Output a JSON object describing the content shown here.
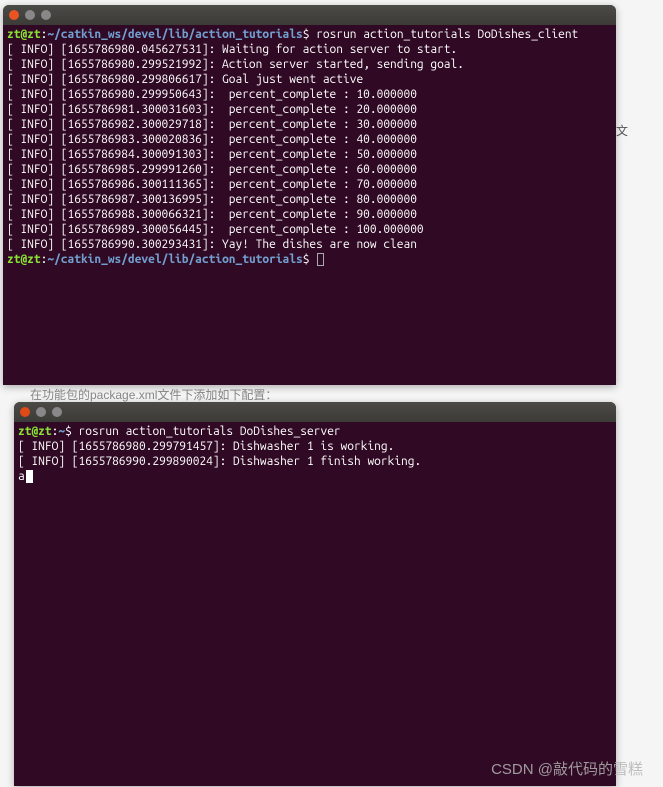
{
  "terminal1": {
    "prompt_user": "zt@zt",
    "prompt_sep": ":",
    "prompt_path": "~/catkin_ws/devel/lib/action_tutorials",
    "prompt_dollar": "$",
    "command": "rosrun action_tutorials DoDishes_client",
    "lines": [
      "[ INFO] [1655786980.045627531]: Waiting for action server to start.",
      "[ INFO] [1655786980.299521992]: Action server started, sending goal.",
      "[ INFO] [1655786980.299806617]: Goal just went active",
      "[ INFO] [1655786980.299950643]:  percent_complete : 10.000000",
      "[ INFO] [1655786981.300031603]:  percent_complete : 20.000000",
      "[ INFO] [1655786982.300029718]:  percent_complete : 30.000000",
      "[ INFO] [1655786983.300020836]:  percent_complete : 40.000000",
      "[ INFO] [1655786984.300091303]:  percent_complete : 50.000000",
      "[ INFO] [1655786985.299991260]:  percent_complete : 60.000000",
      "[ INFO] [1655786986.300111365]:  percent_complete : 70.000000",
      "[ INFO] [1655786987.300136995]:  percent_complete : 80.000000",
      "[ INFO] [1655786988.300066321]:  percent_complete : 90.000000",
      "[ INFO] [1655786989.300056445]:  percent_complete : 100.000000",
      "[ INFO] [1655786990.300293431]: Yay! The dishes are now clean"
    ]
  },
  "terminal2": {
    "prompt_user": "zt@zt",
    "prompt_sep": ":",
    "prompt_path": "~",
    "prompt_dollar": "$",
    "command": "rosrun action_tutorials DoDishes_server",
    "lines": [
      "[ INFO] [1655786980.299791457]: Dishwasher 1 is working.",
      "[ INFO] [1655786990.299890024]: Dishwasher 1 finish working."
    ],
    "trailing": "a"
  },
  "watermark": "CSDN @敲代码的雪糕",
  "side_char": "文",
  "bg_text": "在功能包的package.xml文件下添加如下配置："
}
